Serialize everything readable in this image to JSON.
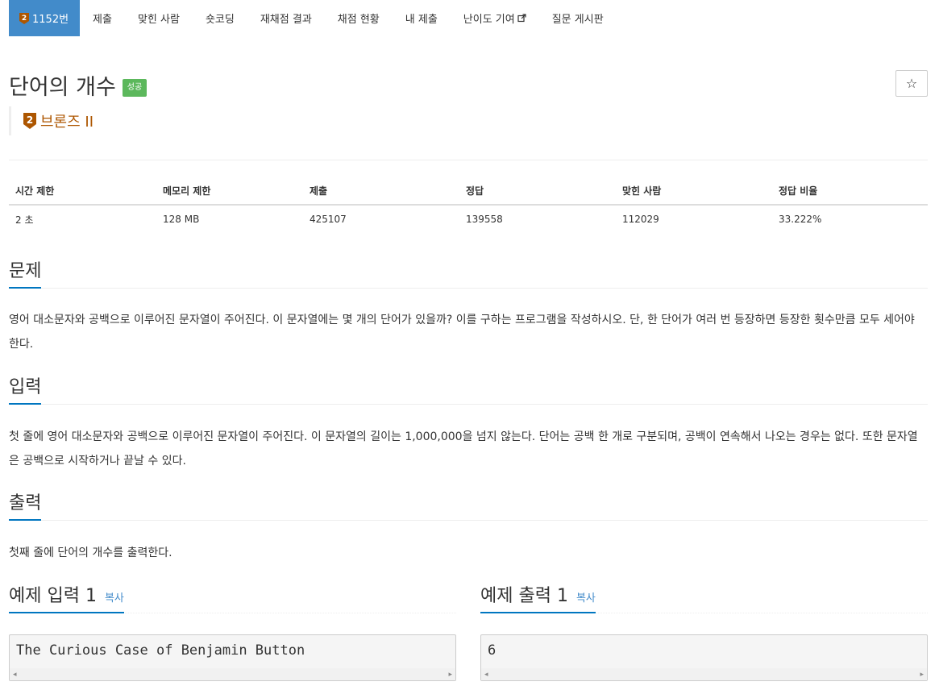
{
  "nav": {
    "problem_no": "1152번",
    "tabs": [
      "제출",
      "맞힌 사람",
      "숏코딩",
      "재채점 결과",
      "채점 현황",
      "내 제출",
      "난이도 기여",
      "질문 게시판"
    ]
  },
  "problem": {
    "title": "단어의 개수",
    "status": "성공",
    "tier": "브론즈 II",
    "star": "☆"
  },
  "info": {
    "headers": [
      "시간 제한",
      "메모리 제한",
      "제출",
      "정답",
      "맞힌 사람",
      "정답 비율"
    ],
    "values": [
      "2 초",
      "128 MB",
      "425107",
      "139558",
      "112029",
      "33.222%"
    ]
  },
  "sections": {
    "description": {
      "title": "문제",
      "text": "영어 대소문자와 공백으로 이루어진 문자열이 주어진다. 이 문자열에는 몇 개의 단어가 있을까? 이를 구하는 프로그램을 작성하시오. 단, 한 단어가 여러 번 등장하면 등장한 횟수만큼 모두 세어야 한다."
    },
    "input": {
      "title": "입력",
      "text": "첫 줄에 영어 대소문자와 공백으로 이루어진 문자열이 주어진다. 이 문자열의 길이는 1,000,000을 넘지 않는다. 단어는 공백 한 개로 구분되며, 공백이 연속해서 나오는 경우는 없다. 또한 문자열은 공백으로 시작하거나 끝날 수 있다."
    },
    "output": {
      "title": "출력",
      "text": "첫째 줄에 단어의 개수를 출력한다."
    }
  },
  "samples": {
    "input_title": "예제 입력 1",
    "output_title": "예제 출력 1",
    "copy_label": "복사",
    "input_value": "The Curious Case of Benjamin Button",
    "output_value": "6"
  },
  "colors": {
    "accent": "#428bca",
    "success": "#5cb85c",
    "bronze": "#ad5600",
    "section_underline": "#0076c0"
  }
}
